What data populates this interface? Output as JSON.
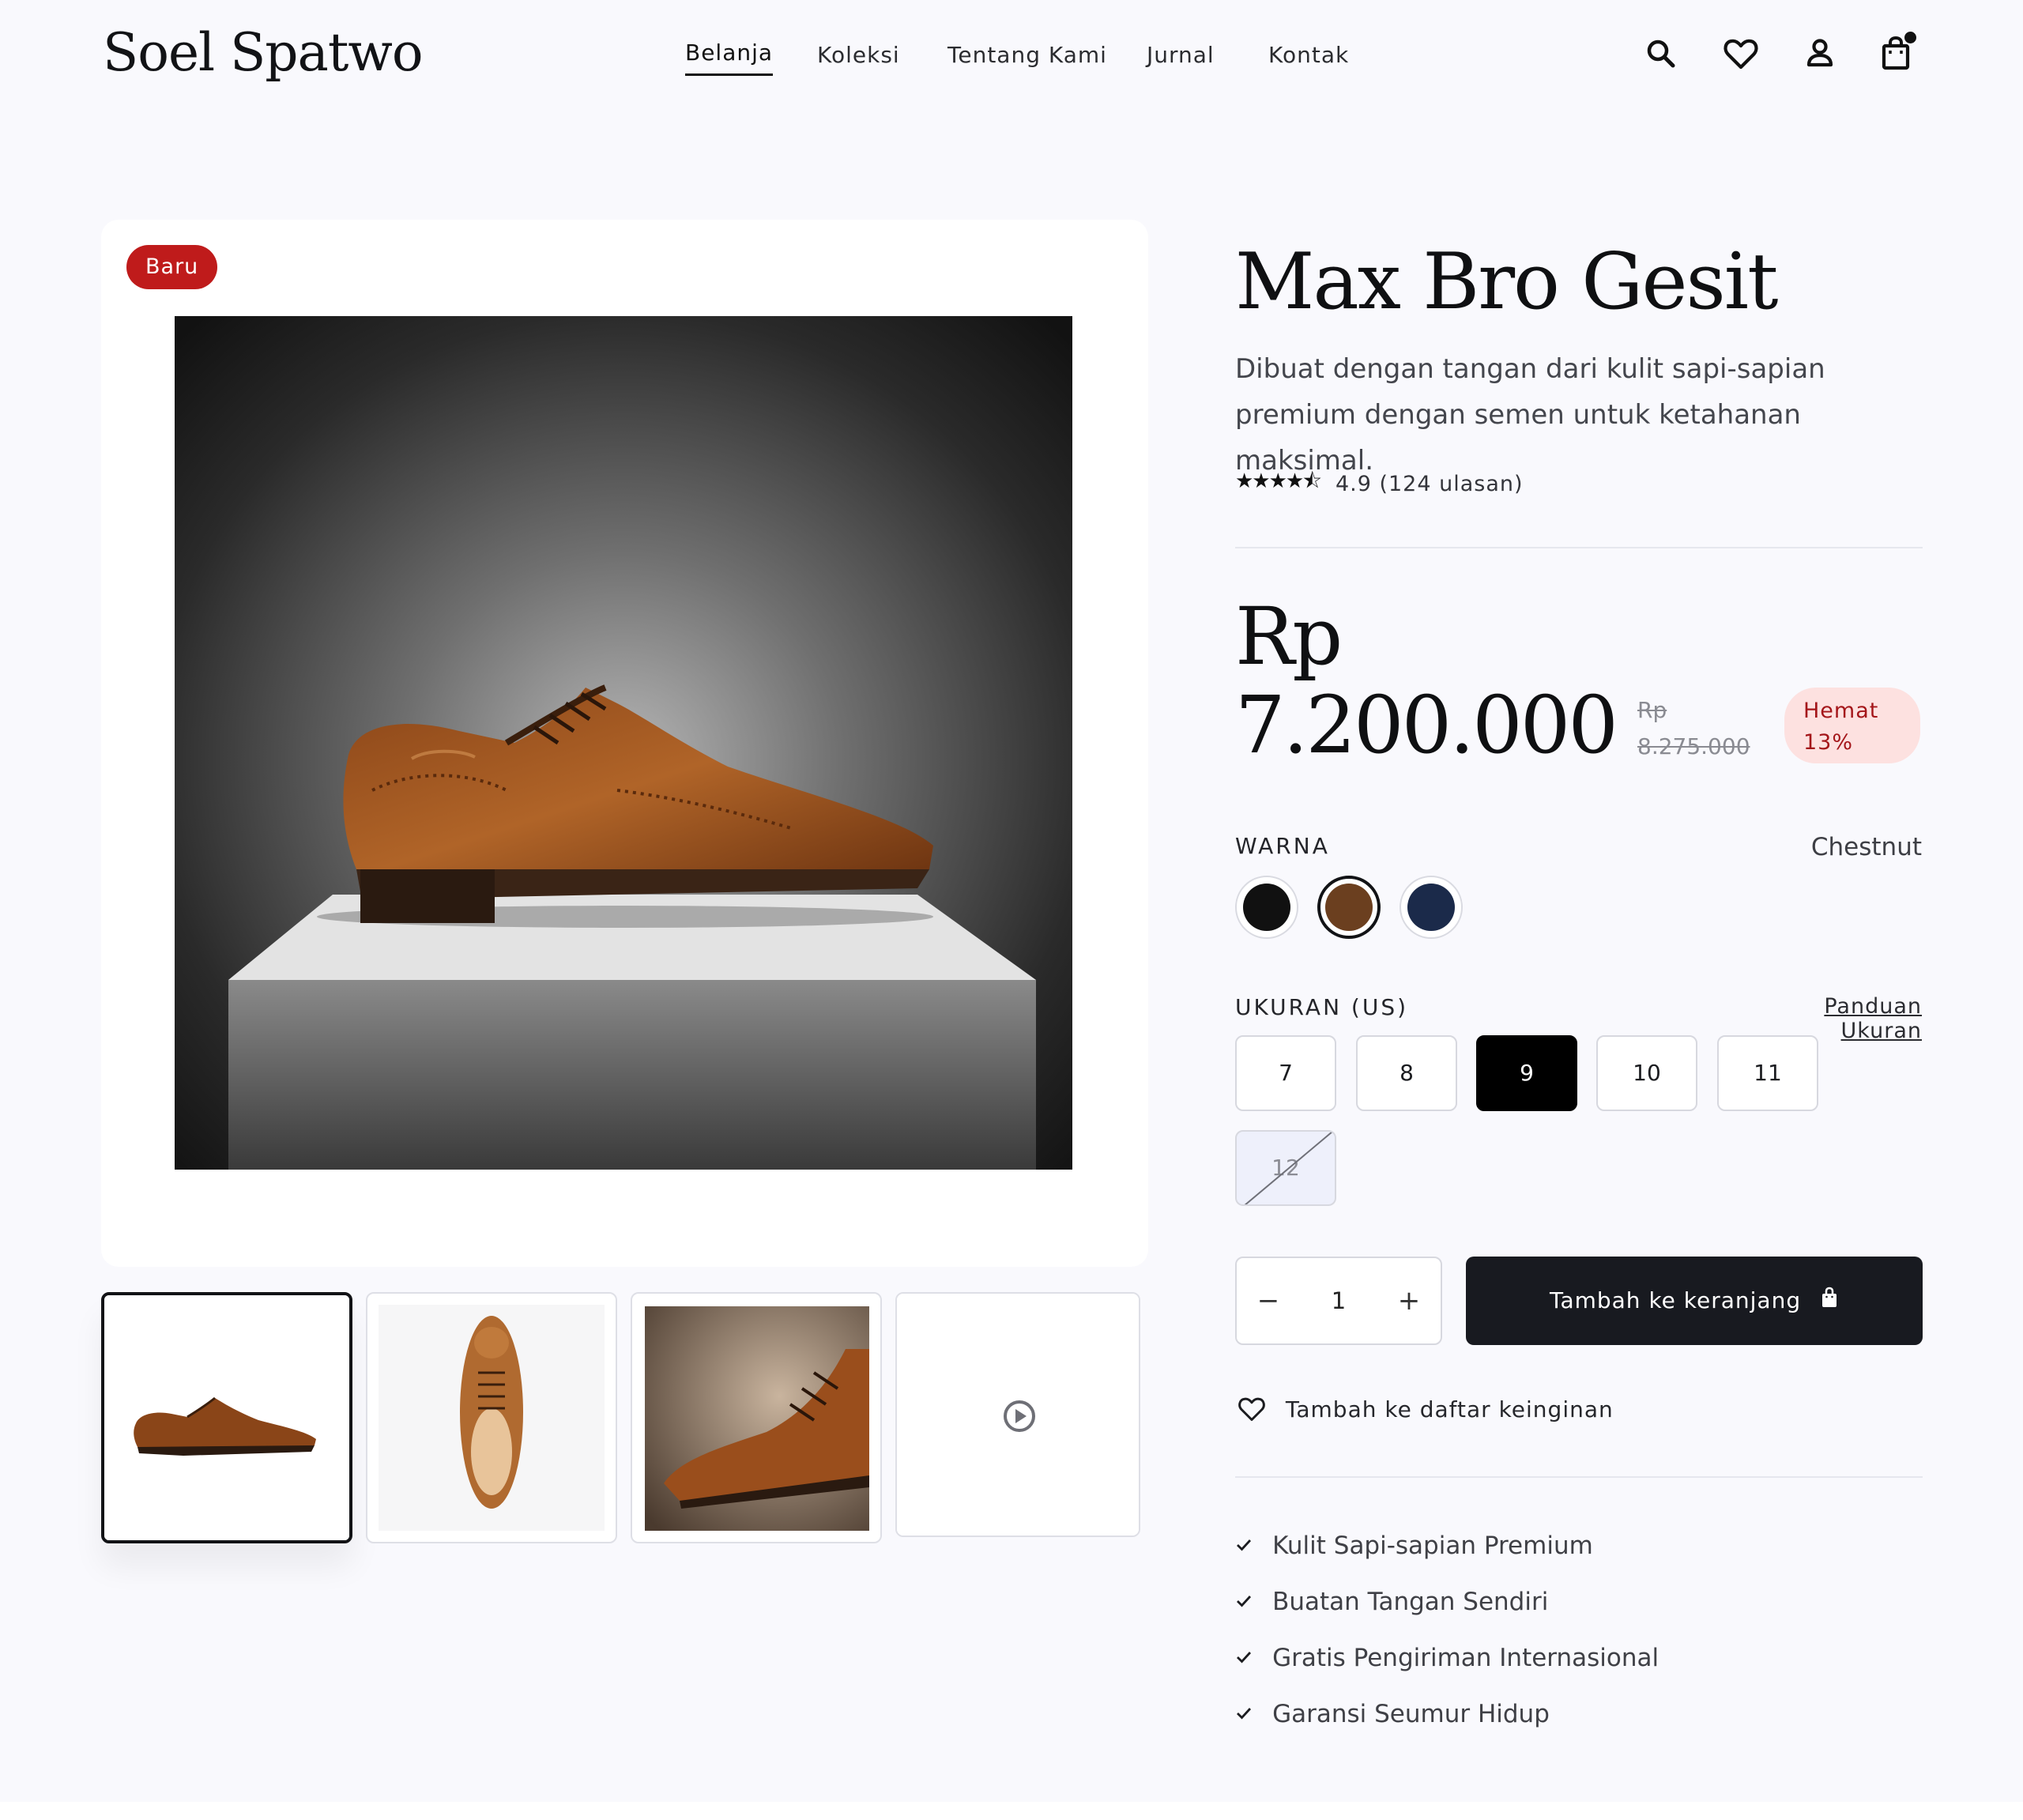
{
  "brand": {
    "name": "Soel Spatwo"
  },
  "nav": {
    "items": [
      "Belanja",
      "Koleksi",
      "Tentang Kami",
      "Jurnal",
      "Kontak"
    ],
    "active": "Belanja"
  },
  "header_icons": [
    "search-icon",
    "heart-icon",
    "user-icon",
    "shopping-bag-icon"
  ],
  "gallery": {
    "badge": "Baru",
    "thumbnails": [
      "side-view",
      "top-view",
      "close-up",
      "video"
    ]
  },
  "product": {
    "title": "Max Bro Gesit",
    "description": "Dibuat dengan tangan dari kulit sapi-sapian premium dengan semen untuk ketahanan maksimal.",
    "rating": {
      "stars": "★★★★⯪",
      "text": "4.9 (124 ulasan)",
      "value": 4.9,
      "reviews": 124
    },
    "price": "Rp 7.200.000",
    "old_price": "Rp 8.275.000",
    "save_badge": "Hemat 13%"
  },
  "color": {
    "label": "WARNA",
    "selected_name": "Chestnut",
    "swatches": [
      {
        "name": "black",
        "hex": "#111111"
      },
      {
        "name": "chestnut",
        "hex": "#6b3f1f",
        "selected": true
      },
      {
        "name": "navy",
        "hex": "#1b2a4a"
      }
    ]
  },
  "size": {
    "label": "UKURAN (US)",
    "guide_link": "Panduan Ukuran",
    "options": [
      "7",
      "8",
      "9",
      "10",
      "11",
      "12"
    ],
    "selected": "9",
    "unavailable": [
      "12"
    ]
  },
  "quantity": {
    "minus": "−",
    "value": "1",
    "plus": "+"
  },
  "actions": {
    "add_to_cart": "Tambah ke keranjang",
    "wishlist": "Tambah ke daftar keinginan"
  },
  "features": [
    "Kulit Sapi-sapian Premium",
    "Buatan Tangan Sendiri",
    "Gratis Pengiriman Internasional",
    "Garansi Seumur Hidup"
  ],
  "colors": {
    "background": "#f9f9fd",
    "primary_button": "#181a20",
    "badge_new": "#bf1b1b",
    "save_badge_bg": "#fde1e0",
    "save_badge_text": "#a4161a"
  }
}
